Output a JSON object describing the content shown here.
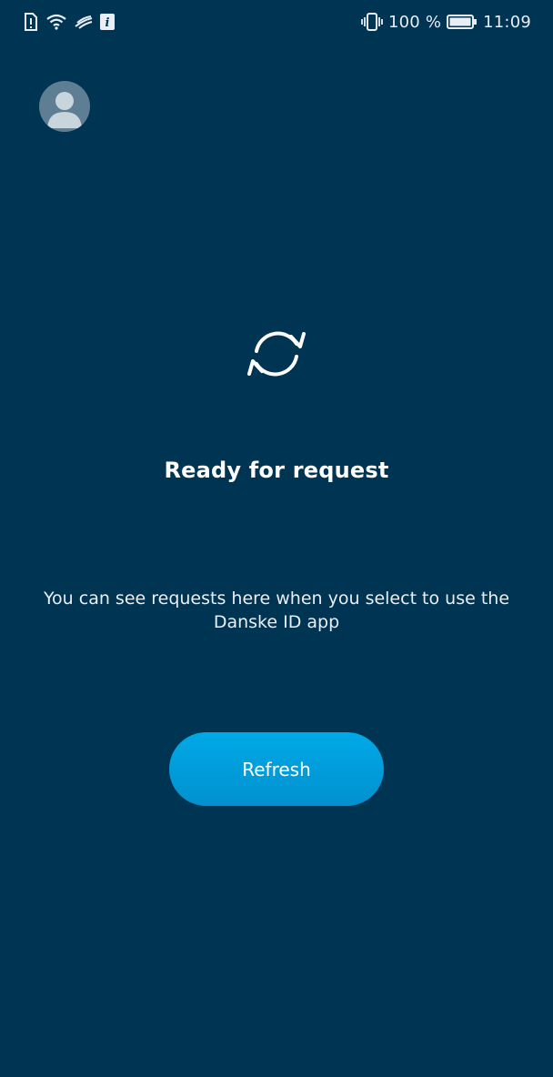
{
  "status_bar": {
    "battery_percent": "100 %",
    "time": "11:09",
    "icons": [
      "sim-alert-icon",
      "wifi-icon",
      "signal-icon",
      "info-icon",
      "vibrate-icon",
      "battery-icon"
    ]
  },
  "profile": {
    "avatar_icon": "user-avatar-icon"
  },
  "main": {
    "icon": "sync-icon",
    "title": "Ready for request",
    "description": "You can see requests here when you select to use the Danske ID app",
    "refresh_label": "Refresh"
  },
  "colors": {
    "background": "#003453",
    "button": "#00a0dc",
    "avatar": "#5e7e93"
  }
}
